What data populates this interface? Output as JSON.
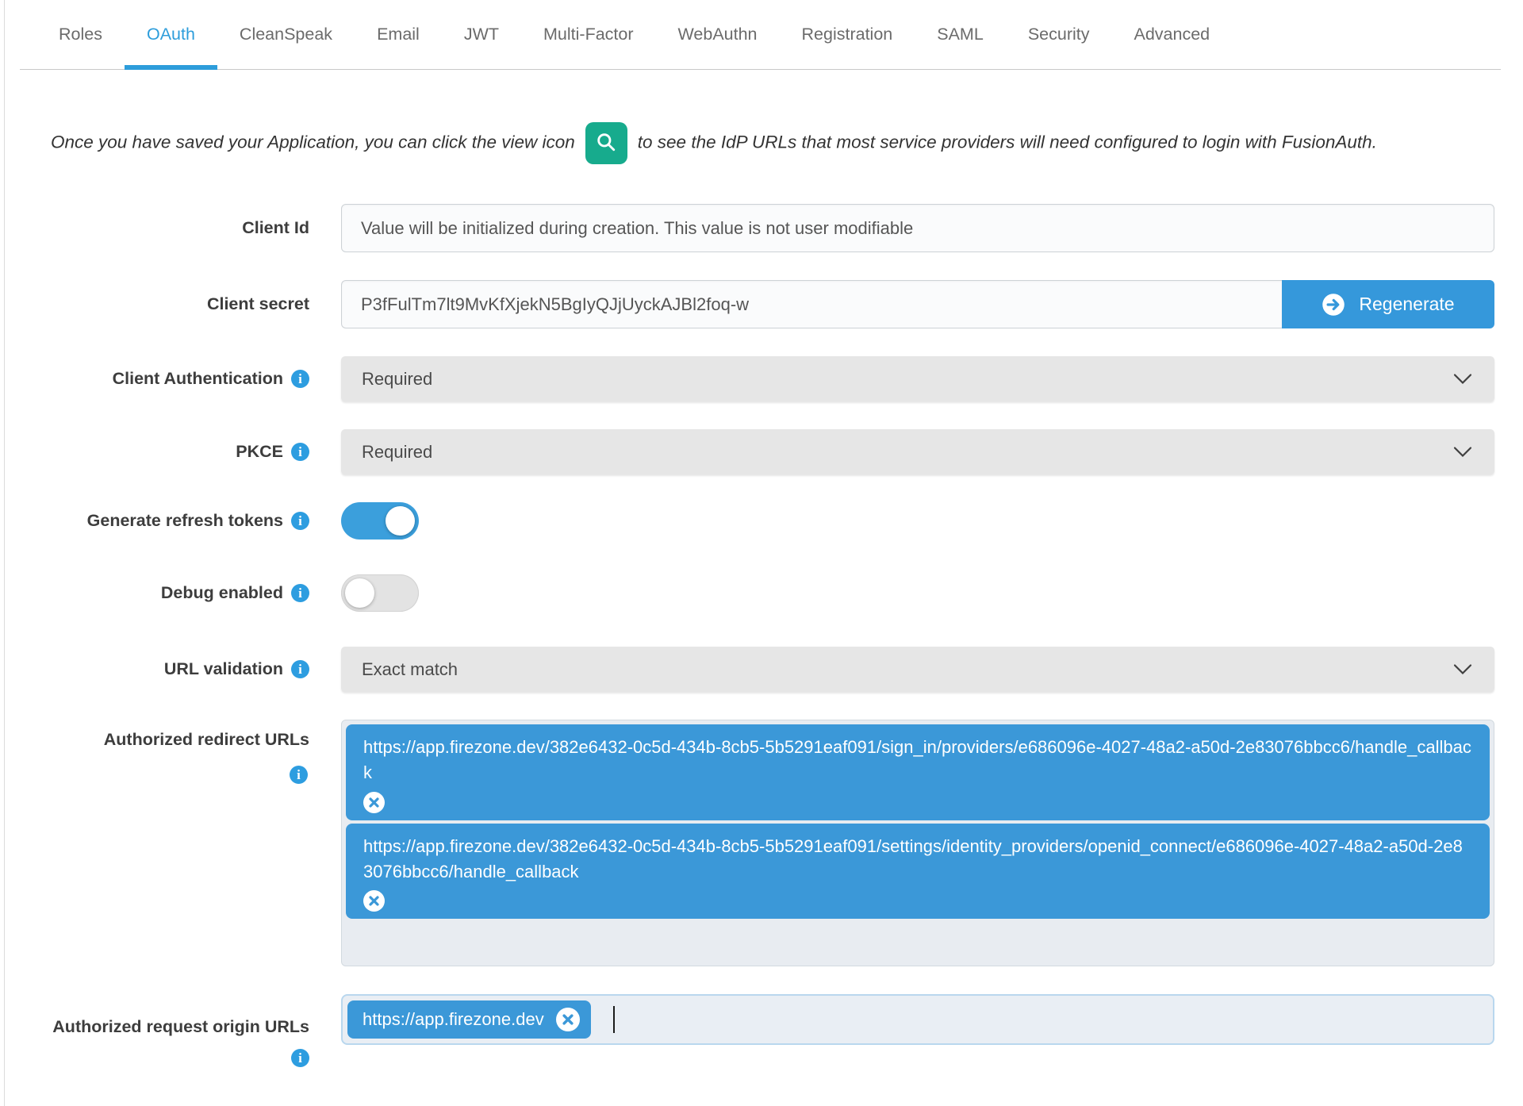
{
  "tabs": {
    "items": [
      "Roles",
      "OAuth",
      "CleanSpeak",
      "Email",
      "JWT",
      "Multi-Factor",
      "WebAuthn",
      "Registration",
      "SAML",
      "Security",
      "Advanced"
    ],
    "active": "OAuth"
  },
  "intro": {
    "text_before_icon": "Once you have saved your Application, you can click the view icon",
    "text_after_icon": "to see the IdP URLs that most service providers will need configured to login with FusionAuth."
  },
  "form": {
    "client_id": {
      "label": "Client Id",
      "value": "Value will be initialized during creation. This value is not user modifiable"
    },
    "client_secret": {
      "label": "Client secret",
      "value": "P3fFulTm7lt9MvKfXjekN5BgIyQJjUyckAJBl2foq-w",
      "regenerate_label": "Regenerate"
    },
    "client_authentication": {
      "label": "Client Authentication",
      "value": "Required"
    },
    "pkce": {
      "label": "PKCE",
      "value": "Required"
    },
    "generate_refresh_tokens": {
      "label": "Generate refresh tokens",
      "enabled": true
    },
    "debug_enabled": {
      "label": "Debug enabled",
      "enabled": false
    },
    "url_validation": {
      "label": "URL validation",
      "value": "Exact match"
    },
    "authorized_redirect_urls": {
      "label": "Authorized redirect URLs",
      "urls": [
        "https://app.firezone.dev/382e6432-0c5d-434b-8cb5-5b5291eaf091/sign_in/providers/e686096e-4027-48a2-a50d-2e83076bbcc6/handle_callback",
        "https://app.firezone.dev/382e6432-0c5d-434b-8cb5-5b5291eaf091/settings/identity_providers/openid_connect/e686096e-4027-48a2-a50d-2e83076bbcc6/handle_callback"
      ]
    },
    "authorized_request_origin_urls": {
      "label": "Authorized request origin URLs",
      "urls": [
        "https://app.firezone.dev"
      ]
    }
  },
  "icons": {
    "view": "search-icon",
    "regenerate": "arrow-circle-right-icon",
    "info": "info-circle-icon",
    "select_caret": "chevron-down-icon",
    "remove_url": "times-circle-icon"
  },
  "colors": {
    "accent_blue": "#3598db",
    "active_tab_blue": "#2d9ddb",
    "chip_blue": "#3b98d8",
    "info_blue": "#2d9de0",
    "view_green": "#17ab8d",
    "select_gray": "#e6e6e6",
    "urls_box_gray": "#e8ecf1",
    "origin_focus_border": "#b9d7ee"
  }
}
